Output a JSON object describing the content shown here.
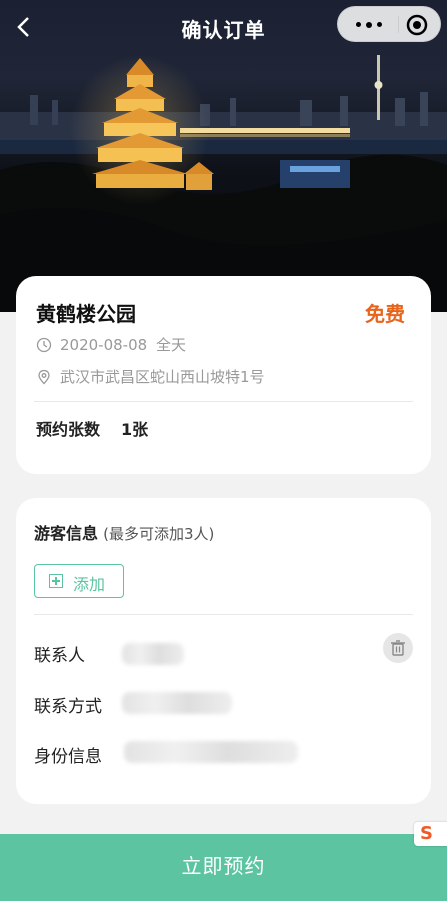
{
  "nav": {
    "title": "确认订单",
    "back_icon": "chevron-left-icon",
    "more_icon": "more-dots-icon",
    "close_icon": "target-close-icon"
  },
  "place": {
    "name": "黄鹤楼公园",
    "price": "免费",
    "date": "2020-08-08",
    "time": "全天",
    "address": "武汉市武昌区蛇山西山坡特1号"
  },
  "ticket": {
    "label": "预约张数",
    "value": "1张"
  },
  "visitors": {
    "title": "游客信息",
    "hint": "(最多可添加3人)",
    "add_label": "添加",
    "fields": {
      "contact_label": "联系人",
      "phone_label": "联系方式",
      "id_label": "身份信息"
    }
  },
  "footer": {
    "submit_label": "立即预约"
  },
  "colors": {
    "accent": "#5cc4a1",
    "price": "#e8641b"
  }
}
